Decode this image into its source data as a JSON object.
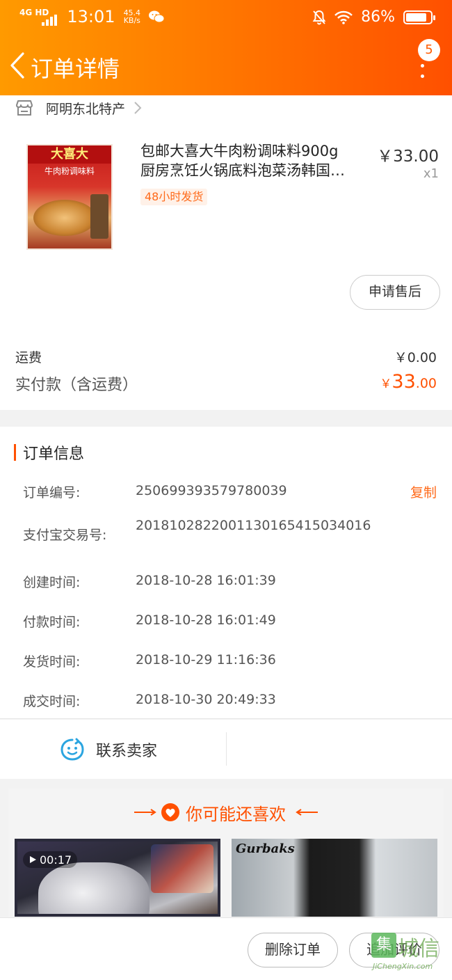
{
  "status_bar": {
    "network": "4G HD",
    "time": "13:01",
    "speed_value": "45.4",
    "speed_unit": "KB/s",
    "battery": "86%",
    "battery_level": 0.86
  },
  "header": {
    "title": "订单详情",
    "notification_count": "5"
  },
  "shop": {
    "name": "阿明东北特产"
  },
  "product": {
    "title_line1": "包邮大喜大牛肉粉调味料900g",
    "title_line2": "厨房烹饪火锅底料泡菜汤韩国…",
    "price": "￥33.00",
    "quantity": "x1",
    "tag": "48小时发货",
    "image_brand": "大喜大",
    "image_subtitle": "牛肉粉调味料",
    "after_sale_label": "申请售后"
  },
  "summary": {
    "shipping_label": "运费",
    "shipping_value": "￥0.00",
    "paid_label": "实付款（含运费）",
    "paid_currency": "￥",
    "paid_int": "33",
    "paid_dec": ".00"
  },
  "order_info": {
    "heading": "订单信息",
    "copy_label": "复制",
    "rows": [
      {
        "label": "订单编号:",
        "value": "250699393579780039"
      },
      {
        "label": "支付宝交易号:",
        "value": "2018102822001130165415034016"
      },
      {
        "label": "创建时间:",
        "value": "2018-10-28 16:01:39"
      },
      {
        "label": "付款时间:",
        "value": "2018-10-28 16:01:49"
      },
      {
        "label": "发货时间:",
        "value": "2018-10-29 11:16:36"
      },
      {
        "label": "成交时间:",
        "value": "2018-10-30 20:49:33"
      }
    ]
  },
  "contact": {
    "label": "联系卖家"
  },
  "recommendations": {
    "heading": "你可能还喜欢",
    "video_duration": "00:17",
    "item2_brand": "Gurbaks"
  },
  "bottom_bar": {
    "delete_label": "删除订单",
    "review_label": "追加评价"
  },
  "watermark": {
    "text": "城信",
    "url": "JiChengXin.com"
  },
  "colors": {
    "accent": "#ff5000",
    "header_start": "#ff9a00",
    "header_end": "#ff5000",
    "contact_icon": "#2ba5e0"
  }
}
